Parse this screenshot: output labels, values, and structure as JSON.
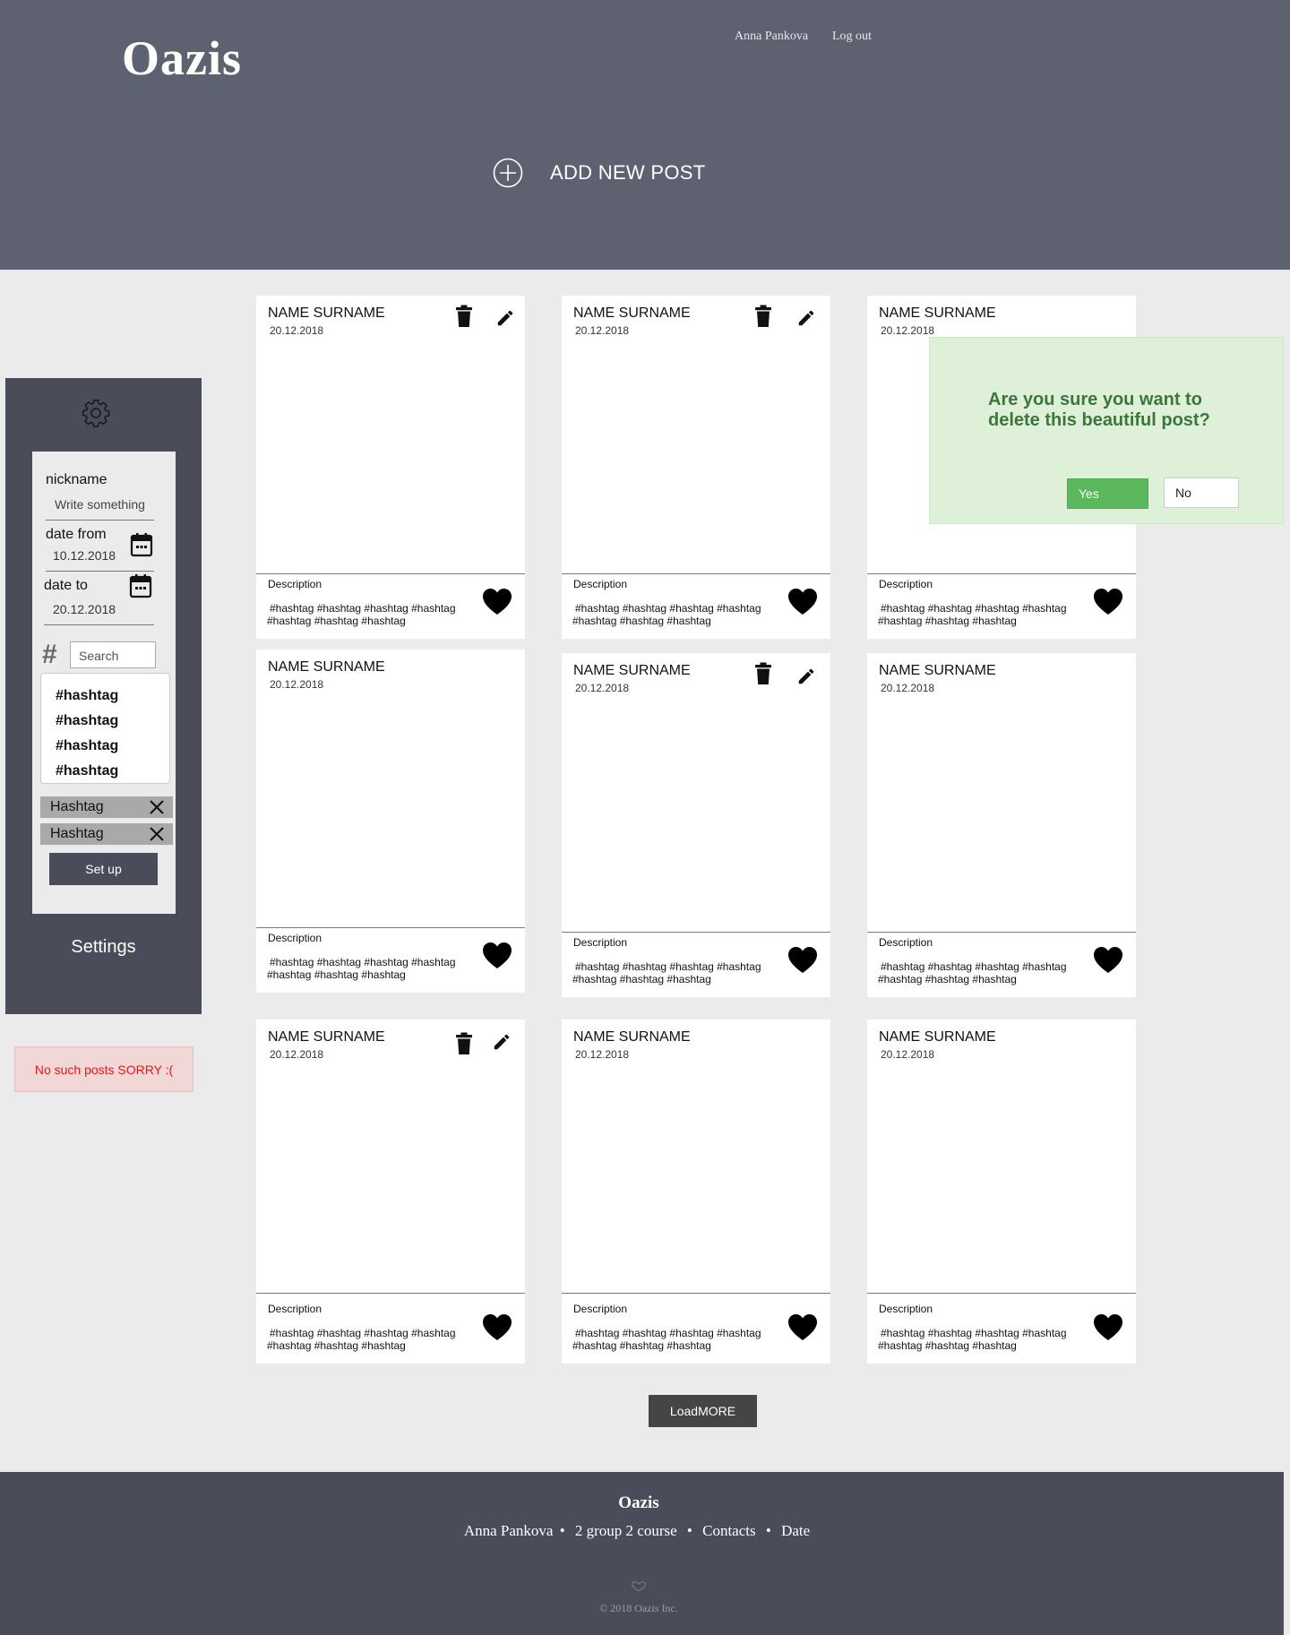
{
  "header": {
    "logo": "Oazis",
    "user_name": "Anna Pankova",
    "logout": "Log out",
    "add_post": "ADD NEW POST"
  },
  "filter": {
    "nickname_label": "nickname",
    "nickname_placeholder": "Write something",
    "date_from_label": "date from",
    "date_from_value": "10.12.2018",
    "date_to_label": "date to",
    "date_to_value": "20.12.2018",
    "hash_symbol": "#",
    "search_placeholder": "Search",
    "hashtag_options": [
      "#hashtag",
      "#hashtag",
      "#hashtag",
      "#hashtag"
    ],
    "selected_hashtags": [
      "Hashtag",
      "Hashtag"
    ],
    "setup_label": "Set up",
    "settings_label": "Settings"
  },
  "no_posts_message": "No such posts SORRY :(",
  "posts": [
    {
      "author": "NAME SURNAME",
      "date": "20.12.2018",
      "description": "Description",
      "tags": "#hashtag #hashtag #hashtag #hashtag #hashtag #hashtag #hashtag",
      "editable": true
    },
    {
      "author": "NAME SURNAME",
      "date": "20.12.2018",
      "description": "Description",
      "tags": "#hashtag #hashtag #hashtag #hashtag #hashtag #hashtag #hashtag",
      "editable": true
    },
    {
      "author": "NAME SURNAME",
      "date": "20.12.2018",
      "description": "Description",
      "tags": "#hashtag #hashtag #hashtag #hashtag #hashtag #hashtag #hashtag",
      "editable": false
    },
    {
      "author": "NAME SURNAME",
      "date": "20.12.2018",
      "description": "Description",
      "tags": "#hashtag #hashtag #hashtag #hashtag #hashtag #hashtag #hashtag",
      "editable": false
    },
    {
      "author": "NAME SURNAME",
      "date": "20.12.2018",
      "description": "Description",
      "tags": "#hashtag #hashtag #hashtag #hashtag #hashtag #hashtag #hashtag",
      "editable": true
    },
    {
      "author": "NAME SURNAME",
      "date": "20.12.2018",
      "description": "Description",
      "tags": "#hashtag #hashtag #hashtag #hashtag #hashtag #hashtag #hashtag",
      "editable": false
    },
    {
      "author": "NAME SURNAME",
      "date": "20.12.2018",
      "description": "Description",
      "tags": "#hashtag #hashtag #hashtag #hashtag #hashtag #hashtag #hashtag",
      "editable": true
    },
    {
      "author": "NAME SURNAME",
      "date": "20.12.2018",
      "description": "Description",
      "tags": "#hashtag #hashtag #hashtag #hashtag #hashtag #hashtag #hashtag",
      "editable": false
    },
    {
      "author": "NAME SURNAME",
      "date": "20.12.2018",
      "description": "Description",
      "tags": "#hashtag #hashtag #hashtag #hashtag #hashtag #hashtag #hashtag",
      "editable": false
    }
  ],
  "delete_dialog": {
    "question": "Are you sure you want to delete this beautiful post?",
    "yes": "Yes",
    "no": "No"
  },
  "load_more": "LoadMORE",
  "footer": {
    "title": "Oazis",
    "links": [
      "Anna Pankova",
      "2 group 2 course",
      "Contacts",
      "Date"
    ],
    "separator": "•",
    "copyright": "© 2018 Oazis Inc."
  },
  "colors": {
    "header_bg": "#5e6270",
    "sidebar_bg": "#4a4c59",
    "page_bg": "#ebebeb",
    "dialog_bg": "#dff0d8",
    "dialog_text": "#3c763d",
    "yes_button": "#5cb85c",
    "error_text": "#e11a1a"
  },
  "icons": [
    "add-circle-icon",
    "gear-icon",
    "calendar-icon",
    "close-icon",
    "trash-icon",
    "pencil-icon",
    "heart-icon"
  ]
}
